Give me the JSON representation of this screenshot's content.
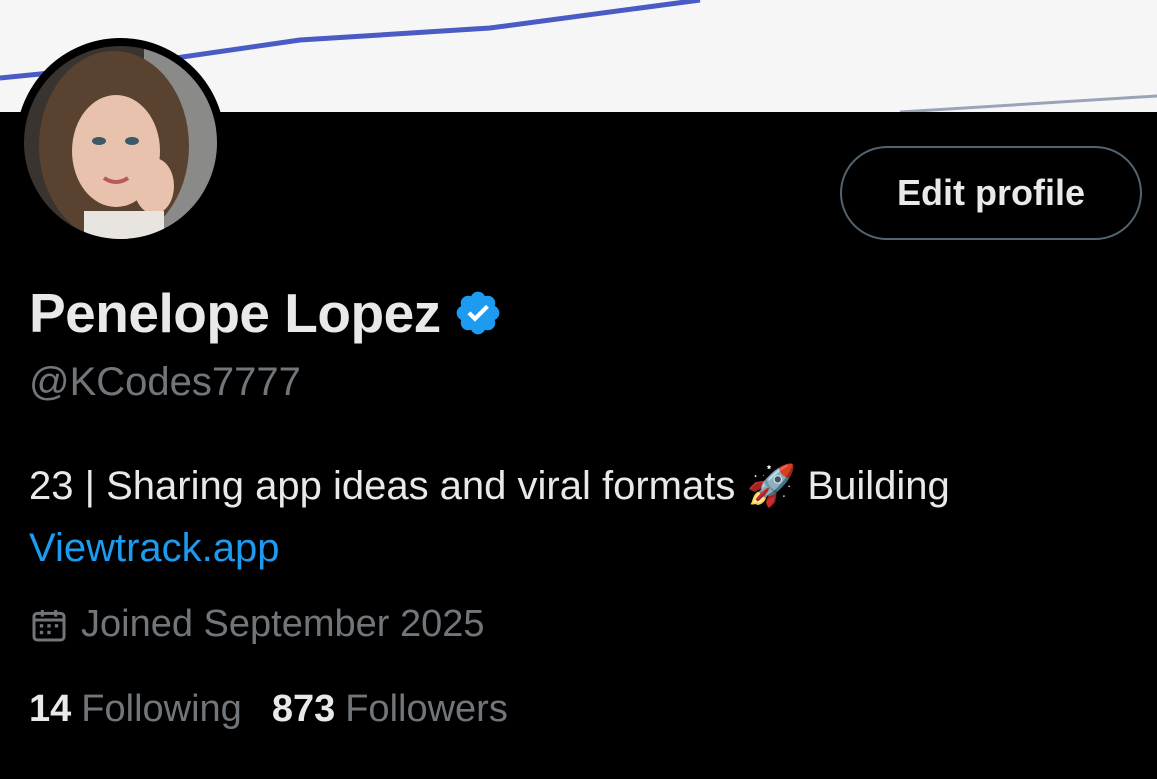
{
  "profile": {
    "display_name": "Penelope Lopez",
    "handle": "@KCodes7777",
    "verified": true,
    "bio_text": "23 | Sharing app ideas and viral formats ",
    "bio_emoji": "🚀",
    "bio_text_after": " Building ",
    "bio_link": "Viewtrack.app",
    "joined": "Joined September 2025"
  },
  "buttons": {
    "edit_profile": "Edit profile"
  },
  "stats": {
    "following_count": "14",
    "following_label": "Following",
    "followers_count": "873",
    "followers_label": "Followers"
  },
  "colors": {
    "background": "#000000",
    "link": "#1d9bf0",
    "verified": "#1d9bf0",
    "secondary_text": "#71767b",
    "banner": "#f6f6f7",
    "banner_line": "#4a5bc4"
  },
  "icons": {
    "verified": "verified-badge-icon",
    "calendar": "calendar-icon"
  }
}
